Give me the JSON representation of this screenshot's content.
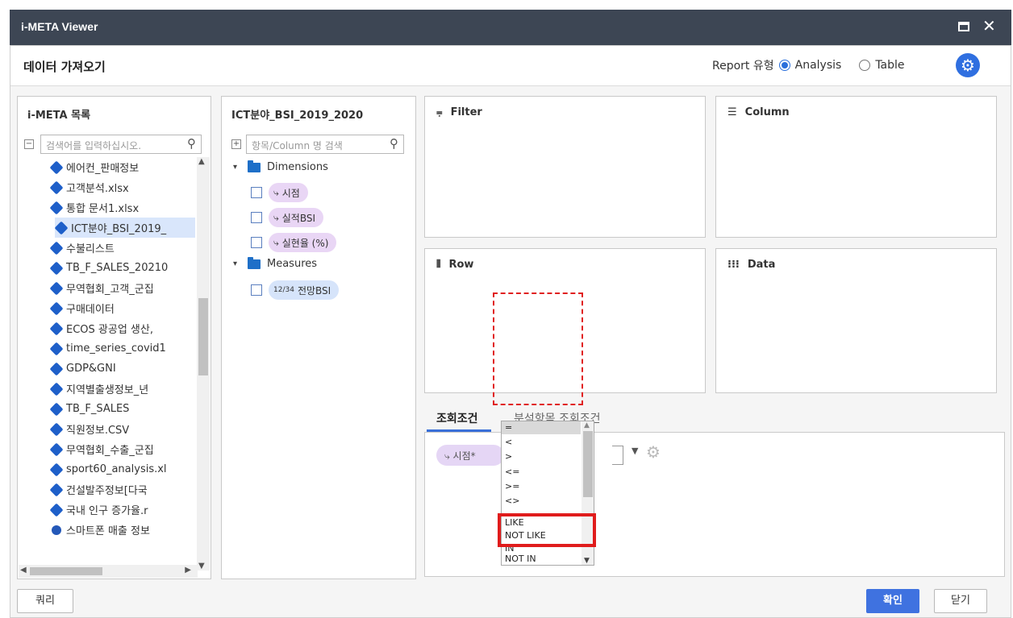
{
  "window": {
    "title": "i-META Viewer"
  },
  "header": {
    "title": "데이터 가져오기",
    "report_label": "Report 유형",
    "options": [
      "Analysis",
      "Table"
    ],
    "selected": "Analysis"
  },
  "meta_panel": {
    "title": "i-META 목록",
    "search_placeholder": "검색어를 입력하십시오.",
    "items": [
      "에어컨_판매정보",
      "고객분석.xlsx",
      "통합 문서1.xlsx",
      "ICT분야_BSI_2019_",
      "수불리스트",
      "TB_F_SALES_20210",
      "무역협회_고객_군집",
      "구매데이터",
      "ECOS 광공업 생산,",
      "time_series_covid1",
      "GDP&GNI",
      "지역별출생정보_년",
      "TB_F_SALES",
      "직원정보.CSV",
      "무역협회_수출_군집",
      "sport60_analysis.xl",
      "건설발주정보[다국",
      "국내 인구 증가율.r",
      "스마트폰 매출 정보"
    ],
    "selected_item": "ICT분야_BSI_2019_"
  },
  "field_panel": {
    "title": "ICT분야_BSI_2019_2020",
    "search_placeholder": "항목/Column 명 검색",
    "dimensions_label": "Dimensions",
    "dimensions": [
      "시점",
      "실적BSI",
      "실현율 (%)"
    ],
    "measures_label": "Measures",
    "measures": [
      "전망BSI"
    ],
    "measure_glyph": "12/34"
  },
  "zones": {
    "filter": "Filter",
    "column": "Column",
    "row": "Row",
    "data": "Data"
  },
  "conditions": {
    "tabs": [
      "조회조건",
      "분석항목 조회조건"
    ],
    "chip_label": "시점*",
    "operators": [
      "=",
      "<",
      ">",
      "<=",
      ">=",
      "<>",
      "LIKE",
      "NOT LIKE",
      "IN",
      "NOT IN"
    ],
    "selected_operator": "="
  },
  "footer": {
    "query": "쿼리",
    "ok": "확인",
    "close": "닫기"
  },
  "colors": {
    "titlebar": "#3d4654",
    "accent": "#3f72e0",
    "dimension_chip": "#e9d6f5",
    "measure_chip": "#d6e4fa",
    "highlight": "#e01c1c"
  }
}
